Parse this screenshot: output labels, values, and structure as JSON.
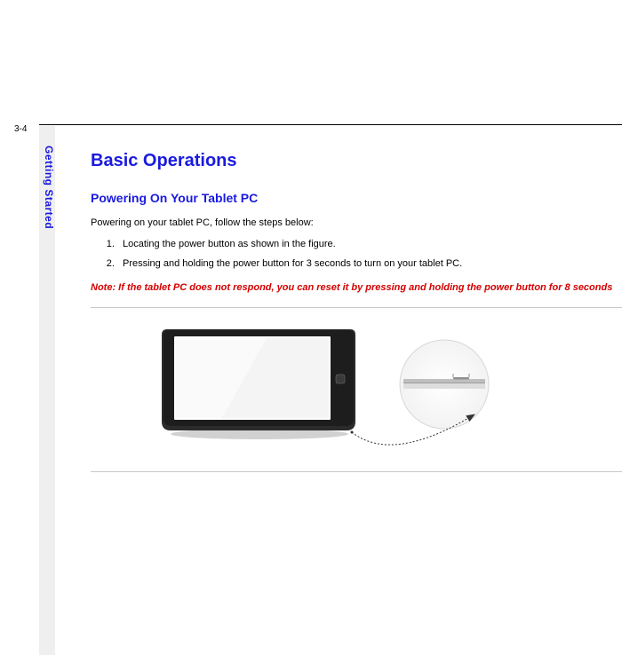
{
  "page_number": "3-4",
  "side_label": "Getting Started",
  "heading": "Basic Operations",
  "subheading": "Powering On Your Tablet PC",
  "intro": "Powering on your tablet PC, follow the steps below:",
  "steps": [
    "Locating the power button as shown in the figure.",
    "Pressing and holding the power button for 3 seconds to turn on your tablet PC."
  ],
  "note": "Note: If the tablet PC does not respond, you can reset it by pressing and holding the power button for 8 seconds"
}
